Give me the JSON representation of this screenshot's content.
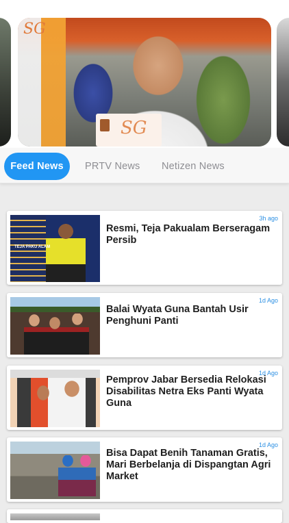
{
  "carousel": {
    "main_photo_card_text": "SG",
    "logo_text": "SG"
  },
  "tabs": [
    {
      "label": "Feed News",
      "active": true
    },
    {
      "label": "PRTV News",
      "active": false
    },
    {
      "label": "Netizen News",
      "active": false
    }
  ],
  "feed": {
    "items": [
      {
        "title": "Resmi, Teja Pakualam Berseragam Persib",
        "time": "3h ago",
        "thumb_text": "TEJA PAKU ALAM"
      },
      {
        "title": " Balai Wyata Guna Bantah Usir Penghuni Panti",
        "time": "1d Ago"
      },
      {
        "title": "Pemprov Jabar Bersedia Relokasi Disabilitas Netra Eks Panti Wyata Guna",
        "time": "1d Ago"
      },
      {
        "title": "Bisa Dapat Benih Tanaman Gratis, Mari Berbelanja di Dispangtan Agri Market",
        "time": "1d Ago"
      }
    ]
  },
  "colors": {
    "accent": "#2196f3",
    "time_text": "#2b8fe3",
    "background": "#ececec"
  }
}
